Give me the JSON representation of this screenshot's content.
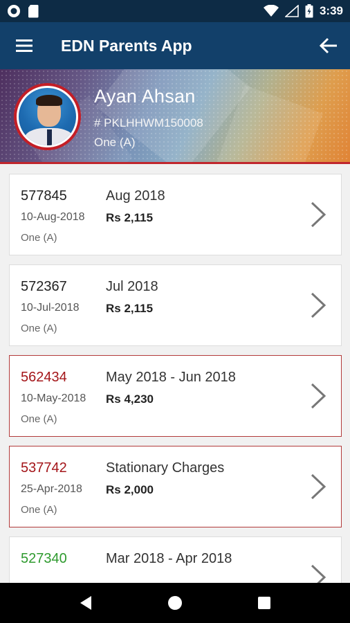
{
  "status_bar": {
    "time": "3:39",
    "icons": [
      "notification-circle-icon",
      "sd-card-icon",
      "wifi-icon",
      "no-signal-icon",
      "battery-icon"
    ]
  },
  "app_bar": {
    "title": "EDN Parents App",
    "menu_icon": "hamburger-menu-icon",
    "back_icon": "arrow-back-icon"
  },
  "profile": {
    "name": "Ayan Ahsan",
    "id": "# PKLHHWM150008",
    "class": "One (A)",
    "accent": "#c0262d"
  },
  "colors": {
    "app_bar": "#12406a",
    "status_bar": "#0d2b45",
    "unpaid": "#a4161a",
    "paid": "#2e9a2e"
  },
  "vouchers": [
    {
      "number": "577845",
      "date": "10-Aug-2018",
      "class": "One (A)",
      "period": "Aug 2018",
      "amount": "Rs 2,115",
      "status": "normal"
    },
    {
      "number": "572367",
      "date": "10-Jul-2018",
      "class": "One (A)",
      "period": "Jul 2018",
      "amount": "Rs 2,115",
      "status": "normal"
    },
    {
      "number": "562434",
      "date": "10-May-2018",
      "class": "One (A)",
      "period": "May 2018 - Jun 2018",
      "amount": "Rs 4,230",
      "status": "unpaid"
    },
    {
      "number": "537742",
      "date": "25-Apr-2018",
      "class": "One (A)",
      "period": "Stationary Charges",
      "amount": "Rs 2,000",
      "status": "unpaid"
    },
    {
      "number": "527340",
      "date": "",
      "class": "",
      "period": "Mar 2018 - Apr 2018",
      "amount": "",
      "status": "paid"
    }
  ],
  "nav_bar": {
    "icons": [
      "back-triangle-icon",
      "home-circle-icon",
      "recents-square-icon"
    ]
  }
}
